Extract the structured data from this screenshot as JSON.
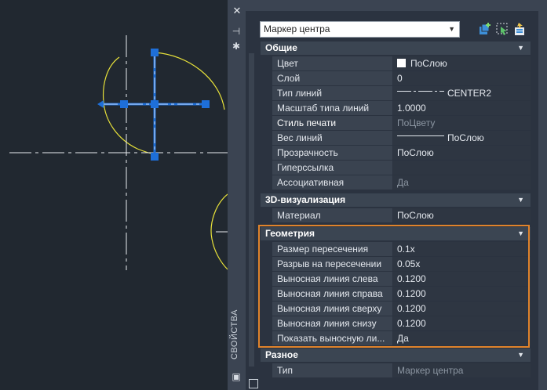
{
  "palette": {
    "vertical_title": "СВОЙСТВА",
    "selector_value": "Маркер центра"
  },
  "sections": [
    {
      "title": "Общие",
      "rows": [
        {
          "label": "Цвет",
          "value": "ПоСлою",
          "swatch": "#ffffff"
        },
        {
          "label": "Слой",
          "value": "0"
        },
        {
          "label": "Тип линий",
          "value": "CENTER2",
          "linetype": "center"
        },
        {
          "label": "Масштаб типа линий",
          "value": "1.0000"
        },
        {
          "label": "Стиль печати",
          "value": "ПоЦвету",
          "dim": true,
          "bold": true
        },
        {
          "label": "Вес линий",
          "value": "ПоСлою",
          "linetype": "solid"
        },
        {
          "label": "Прозрачность",
          "value": "ПоСлою"
        },
        {
          "label": "Гиперссылка",
          "value": ""
        },
        {
          "label": "Ассоциативная",
          "value": "Да",
          "dim": true
        }
      ]
    },
    {
      "title": "3D-визуализация",
      "rows": [
        {
          "label": "Материал",
          "value": "ПоСлою"
        }
      ]
    },
    {
      "title": "Геометрия",
      "rows": [
        {
          "label": "Размер пересечения",
          "value": "0.1x"
        },
        {
          "label": "Разрыв на пересечении",
          "value": "0.05x"
        },
        {
          "label": "Выносная линия слева",
          "value": "0.1200"
        },
        {
          "label": "Выносная линия справа",
          "value": "0.1200"
        },
        {
          "label": "Выносная линия сверху",
          "value": "0.1200"
        },
        {
          "label": "Выносная линия снизу",
          "value": "0.1200"
        },
        {
          "label": "Показать выносную ли...",
          "value": "Да"
        }
      ]
    },
    {
      "title": "Разное",
      "rows": [
        {
          "label": "Тип",
          "value": "Маркер центра",
          "dim": true
        }
      ]
    }
  ],
  "colors": {
    "canvas_bg": "#212830",
    "selection_blue": "#1e6fd9",
    "geometry_yellow": "#e8e23a",
    "highlight_orange": "#e0832b"
  }
}
